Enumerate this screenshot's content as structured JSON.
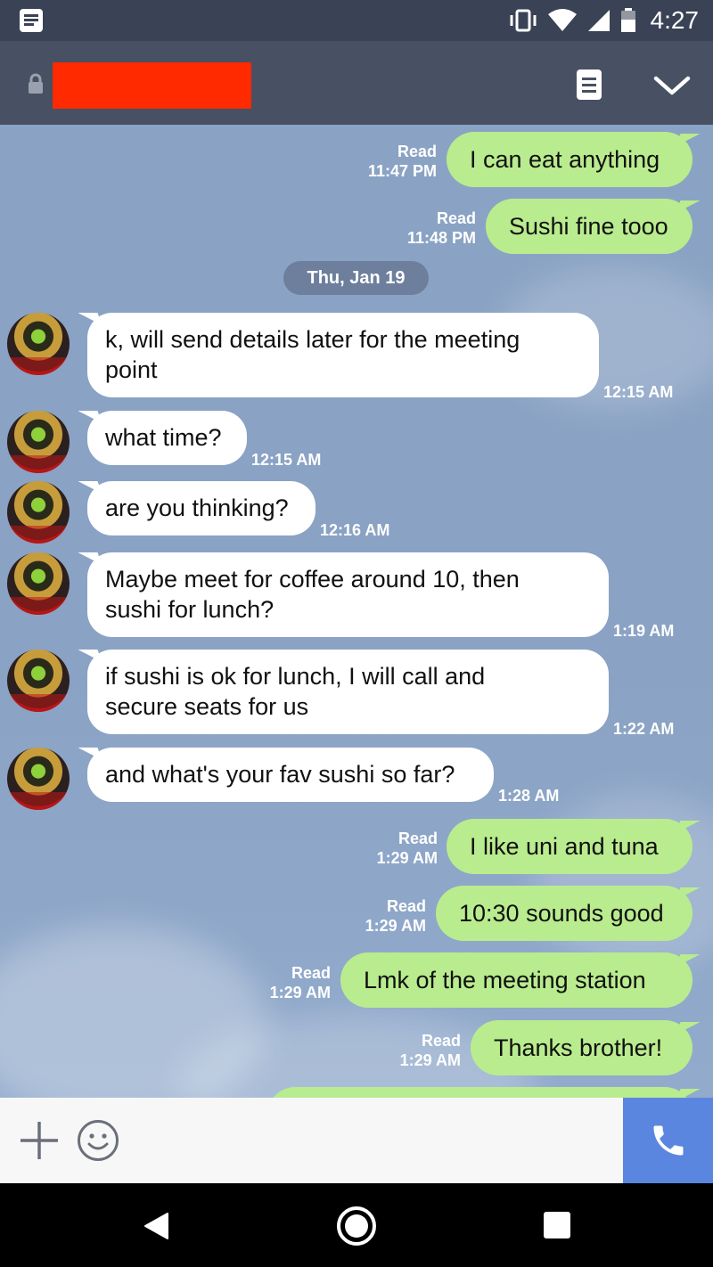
{
  "status_bar": {
    "time": "4:27",
    "icons": [
      "notification-icon",
      "vibrate-icon",
      "wifi-icon",
      "signal-icon",
      "battery-icon"
    ]
  },
  "header": {
    "contact_name": "",
    "icons": [
      "lock-icon",
      "notes-icon",
      "chevron-down-icon"
    ]
  },
  "chat": {
    "date_separator": "Thu, Jan 19",
    "messages": [
      {
        "side": "out",
        "text": "I can eat anything",
        "status": "Read",
        "time": "11:47 PM"
      },
      {
        "side": "out",
        "text": "Sushi fine tooo",
        "status": "Read",
        "time": "11:48 PM"
      },
      {
        "side": "in",
        "lines": [
          "k, will send details later for the meeting",
          "point"
        ],
        "time": "12:15 AM"
      },
      {
        "side": "in",
        "lines": [
          "what time?"
        ],
        "time": "12:15 AM"
      },
      {
        "side": "in",
        "lines": [
          "are you thinking?"
        ],
        "time": "12:16 AM"
      },
      {
        "side": "in",
        "lines": [
          "Maybe meet for coffee around 10, then",
          "sushi for lunch?"
        ],
        "time": "1:19 AM"
      },
      {
        "side": "in",
        "lines": [
          "if sushi is ok for lunch, I will call and",
          "secure seats for us"
        ],
        "time": "1:22 AM"
      },
      {
        "side": "in",
        "lines": [
          "and what's your fav sushi so far?"
        ],
        "time": "1:28 AM"
      },
      {
        "side": "out",
        "text": "I like uni and tuna",
        "status": "Read",
        "time": "1:29 AM"
      },
      {
        "side": "out",
        "text": "10:30 sounds good",
        "status": "Read",
        "time": "1:29 AM"
      },
      {
        "side": "out",
        "text": "Lmk of the meeting station",
        "status": "Read",
        "time": "1:29 AM"
      },
      {
        "side": "out",
        "text": "Thanks brother!",
        "status": "Read",
        "time": "1:29 AM"
      }
    ]
  },
  "input_bar": {
    "icons": [
      "plus-icon",
      "emoji-icon",
      "phone-icon"
    ],
    "accent": "#5b86e0"
  },
  "colors": {
    "outgoing_bubble": "#b9ec8e",
    "incoming_bubble": "#ffffff",
    "header": "#485063",
    "chat_background": "#8aa3c4"
  }
}
